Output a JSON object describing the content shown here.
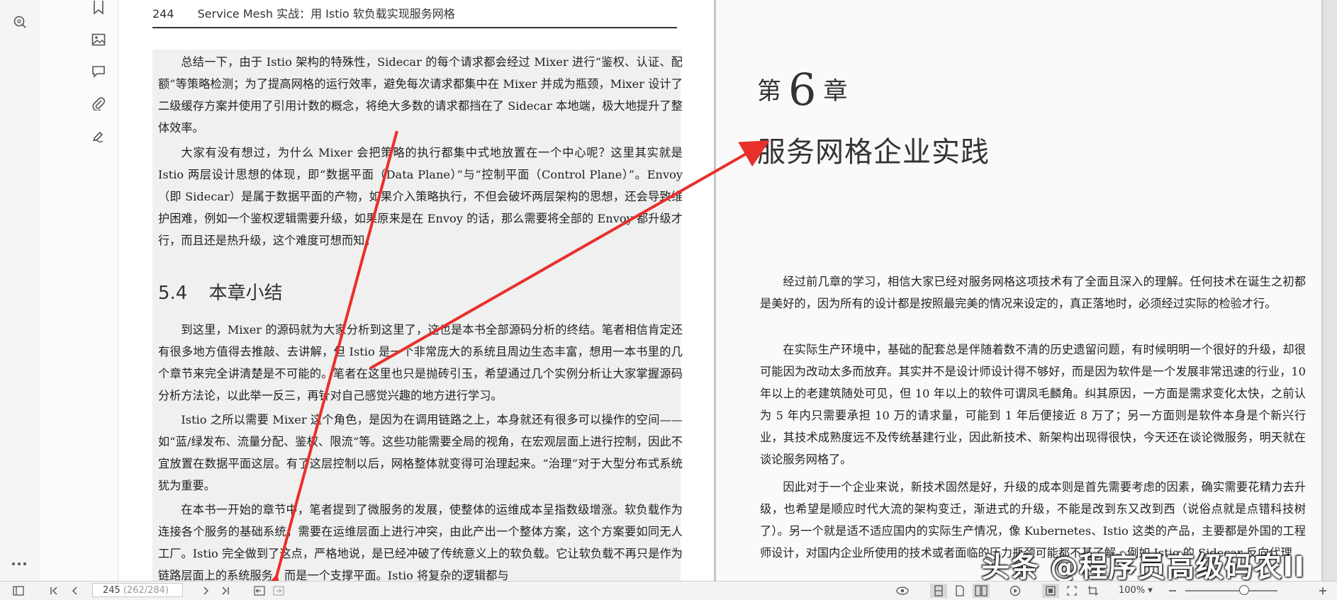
{
  "left_page": {
    "page_number": "244",
    "running_head": "Service Mesh 实战：用 Istio 软负载实现服务网格",
    "paragraphs_top": [
      "总结一下，由于 Istio 架构的特殊性，Sidecar 的每个请求都会经过 Mixer 进行“鉴权、认证、配额”等策略检测；为了提高网格的运行效率，避免每次请求都集中在 Mixer 并成为瓶颈，Mixer 设计了二级缓存方案并使用了引用计数的概念，将绝大多数的请求都挡在了 Sidecar 本地端，极大地提升了整体效率。",
      "大家有没有想过，为什么 Mixer 会把策略的执行都集中式地放置在一个中心呢？这里其实就是 Istio 两层设计思想的体现，即“数据平面（Data Plane）”与“控制平面（Control Plane）”。Envoy（即 Sidecar）是属于数据平面的产物，如果介入策略执行，不但会破坏两层架构的思想，还会导致维护困难，例如一个鉴权逻辑需要升级，如果原来是在 Envoy 的话，那么需要将全部的 Envoy 都升级才行，而且还是热升级，这个难度可想而知。"
    ],
    "section_number": "5.4",
    "section_title": "本章小结",
    "paragraphs_bottom": [
      "到这里，Mixer 的源码就为大家分析到这里了，这也是本书全部源码分析的终结。笔者相信肯定还有很多地方值得去推敲、去讲解，但 Istio 是一个非常庞大的系统且周边生态丰富，想用一本书里的几个章节来完全讲清楚是不可能的。笔者在这里也只是抛砖引玉，希望通过几个实例分析让大家掌握源码分析方法论，以此举一反三，再针对自己感觉兴趣的地方进行学习。",
      "Istio 之所以需要 Mixer 这个角色，是因为在调用链路之上，本身就还有很多可以操作的空间——如“蓝/绿发布、流量分配、鉴权、限流”等。这些功能需要全局的视角，在宏观层面上进行控制，因此不宜放置在数据平面这层。有了这层控制以后，网格整体就变得可治理起来。“治理”对于大型分布式系统犹为重要。",
      "在本书一开始的章节中，笔者提到了微服务的发展，使整体的运维成本呈指数级增涨。软负载作为连接各个服务的基础系统，需要在运维层面上进行冲突，由此产出一个整体方案，这个方案要如同无人工厂。Istio 完全做到了这点，严格地说，是已经冲破了传统意义上的软负载。它让软负载不再只是作为链路层面上的系统服务，而是一个支撑平面。Istio 将复杂的逻辑都与"
    ]
  },
  "right_page": {
    "chapter_prefix": "第",
    "chapter_number": "6",
    "chapter_suffix": "章",
    "chapter_title": "服务网格企业实践",
    "paragraphs": [
      "经过前几章的学习，相信大家已经对服务网格这项技术有了全面且深入的理解。任何技术在诞生之初都是美好的，因为所有的设计都是按照最完美的情况来设定的，真正落地时，必须经过实际的检验才行。",
      "在实际生产环境中，基础的配套总是伴随着数不清的历史遗留问题，有时候明明一个很好的升级，却很可能因为改动太多而放弃。其实并不是设计师设计得不够好，而是因为软件是一个发展非常迅速的行业，10 年以上的老建筑随处可见，但 10 年以上的软件可谓凤毛麟角。纠其原因，一方面是需求变化太快，之前认为 5 年内只需要承担 10 万的请求量，可能到 1 年后便接近 8 万了；另一方面则是软件本身是个新兴行业，其技术成熟度远不及传统基建行业，因此新技术、新架构出现得很快，今天还在谈论微服务，明天就在谈论服务网格了。",
      "因此对于一个企业来说，新技术固然是好，升级的成本则是首先需要考虑的因素，确实需要花精力去升级，也希望是顺应时代大流的架构变迁，渐进式的升级，不能是改到东又改到西（说俗点就是点错科技树了）。另一个就是适不适应国内的实际生产情况，像 Kubernetes、Istio 这类的产品，主要都是外国的工程师设计，对国内企业所使用的技术或者面临的压力瓶颈可能都不甚了解。例如 Istio 的 Sidecar 反向代理"
    ]
  },
  "watermark": "头条 @程序员高级码农II",
  "toolbar": {
    "current_page": "245",
    "page_total": "(262/284)",
    "zoom": "100%"
  },
  "icons": {
    "left_rail": [
      "search-zoom-icon"
    ],
    "second_rail": [
      "bookmark-icon",
      "image-icon",
      "comment-icon",
      "attachment-icon",
      "signature-icon",
      "more-icon"
    ],
    "arrow_color": "#e8302b"
  }
}
